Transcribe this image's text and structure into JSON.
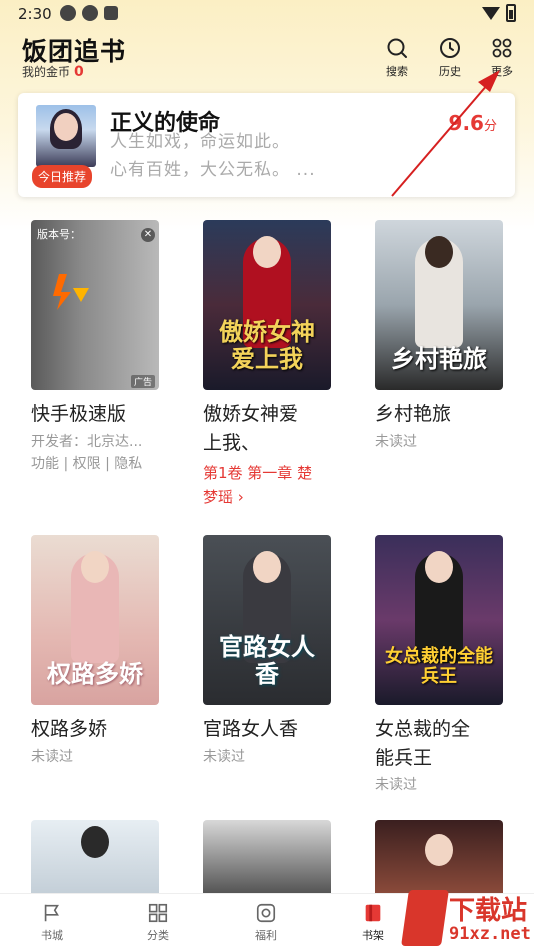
{
  "status_bar": {
    "time": "2:30"
  },
  "header": {
    "title": "饭团追书",
    "coins_label": "我的金币",
    "coins_value": "0",
    "buttons": [
      {
        "label": "搜索",
        "icon": "search-icon"
      },
      {
        "label": "历史",
        "icon": "history-icon"
      },
      {
        "label": "更多",
        "icon": "grid-more-icon"
      }
    ]
  },
  "recommend": {
    "badge": "今日推荐",
    "title": "正义的使命",
    "line1": "人生如戏，命运如此。",
    "line2": "心有百姓，大公无私。 ...",
    "score": "9.6",
    "score_unit": "分"
  },
  "books": [
    {
      "name": "快手极速版",
      "sub1": "开发者：北京达...",
      "sub2": "功能 | 权限 | 隐私",
      "ad": true,
      "ad_tag": "广告",
      "ad_version": "版本号："
    },
    {
      "name_line1": "傲娇女神爱",
      "name_line2": "上我、",
      "chapter_line1": "第1卷 第一章 楚",
      "chapter_line2": "梦瑶 ›",
      "cover_text": "傲娇女神爱上我"
    },
    {
      "name": "乡村艳旅",
      "status": "未读过",
      "cover_text": "乡村艳旅"
    },
    {
      "name": "权路多娇",
      "status": "未读过",
      "cover_text": "权路多娇"
    },
    {
      "name": "官路女人香",
      "status": "未读过",
      "cover_text": "官路女人香"
    },
    {
      "name_line1": "女总裁的全",
      "name_line2": "能兵王",
      "status": "未读过",
      "cover_text": "女总裁的全能兵王"
    }
  ],
  "bottom_nav": [
    {
      "label": "书城",
      "icon": "bookstore-icon"
    },
    {
      "label": "分类",
      "icon": "category-icon"
    },
    {
      "label": "福利",
      "icon": "welfare-icon"
    },
    {
      "label": "书架",
      "icon": "bookshelf-icon",
      "active": true
    }
  ],
  "watermark": {
    "text1": "下载站",
    "text2": "91xz.net"
  },
  "colors": {
    "accent_red": "#e53935",
    "header_bg": "#fbefc4",
    "badge": "#e8442c"
  }
}
